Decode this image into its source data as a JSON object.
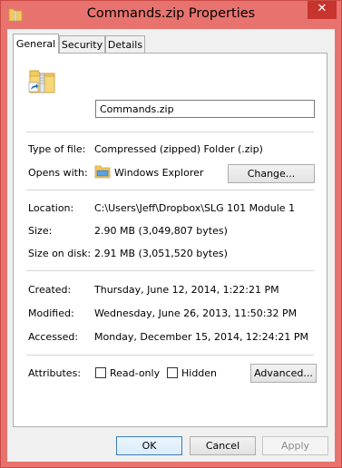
{
  "window": {
    "title": "Commands.zip Properties",
    "close_glyph": "✕"
  },
  "tabs": [
    {
      "label": "General",
      "active": true
    },
    {
      "label": "Security",
      "active": false
    },
    {
      "label": "Details",
      "active": false
    }
  ],
  "general": {
    "file_name": "Commands.zip",
    "type_label": "Type of file:",
    "type_value": "Compressed (zipped) Folder (.zip)",
    "opens_label": "Opens with:",
    "opens_value": "Windows Explorer",
    "change_button": "Change...",
    "location_label": "Location:",
    "location_value": "C:\\Users\\Jeff\\Dropbox\\SLG 101 Module 1",
    "size_label": "Size:",
    "size_value": "2.90 MB (3,049,807 bytes)",
    "size_on_disk_label": "Size on disk:",
    "size_on_disk_value": "2.91 MB (3,051,520 bytes)",
    "created_label": "Created:",
    "created_value": "Thursday, June 12, 2014, 1:22:21 PM",
    "modified_label": "Modified:",
    "modified_value": "Wednesday, June 26, 2013, 11:50:32 PM",
    "accessed_label": "Accessed:",
    "accessed_value": "Monday, December 15, 2014, 12:24:21 PM",
    "attributes_label": "Attributes:",
    "readonly_label": "Read-only",
    "readonly_checked": false,
    "hidden_label": "Hidden",
    "hidden_checked": false,
    "advanced_button": "Advanced..."
  },
  "footer": {
    "ok": "OK",
    "cancel": "Cancel",
    "apply": "Apply"
  },
  "icons": {
    "file_icon": "zip-folder-icon",
    "opens_icon": "windows-explorer-icon"
  }
}
